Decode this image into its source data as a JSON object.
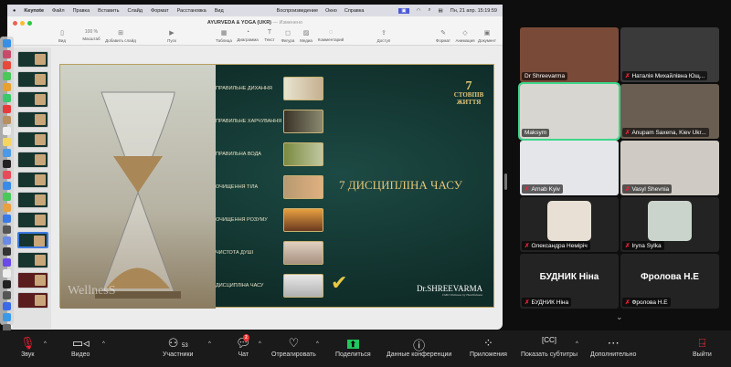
{
  "menubar": {
    "app": "Keynote",
    "items": [
      "Файл",
      "Правка",
      "Вставить",
      "Слайд",
      "Формат",
      "Расстановка",
      "Вид",
      "Воспроизведение",
      "Окно",
      "Справка"
    ],
    "datetime": "Пн, 21 апр. 15:19:59"
  },
  "window": {
    "title": "AYURVEDA & YOGA (UKR)",
    "status": "— Изменено"
  },
  "toolbar": {
    "view": "Вид",
    "zoom_value": "100 %",
    "zoom": "Масштаб",
    "add_slide": "Добавить слайд",
    "play": "Пуск",
    "table": "Таблица",
    "chart": "Диаграмма",
    "text": "Текст",
    "shape": "Фигура",
    "media": "Медиа",
    "comment": "Комментарий",
    "access": "Доступ",
    "format": "Формат",
    "animate": "Анимация",
    "document": "Документ"
  },
  "slide": {
    "title": "7 ДИСЦИПЛІНА ЧАСУ",
    "items": [
      "ПРАВИЛЬНЕ ДИХАННЯ",
      "ПРАВИЛЬНЕ ХАРЧУВАННЯ",
      "ПРАВИЛЬНА ВОДА",
      "ОЧИЩЕННЯ ТІЛА",
      "ОЧИЩЕННЯ РОЗУМУ",
      "ЧИСТОТА ДУШІ",
      "ДИСЦИПЛІНА ЧАСУ"
    ],
    "logo_number": "7",
    "logo_text": "СТОВПІВ ЖИТТЯ",
    "brand": "Dr.SHREEVARMA",
    "brand_sub": "CMD Wellness by Heartfulness",
    "watermark": "WellnesS",
    "check": "✔"
  },
  "participants": [
    {
      "name": "Dr Shreevarma",
      "muted": false,
      "color": "#7a4a38"
    },
    {
      "name": "Наталія Михайлівна Ющ...",
      "muted": true,
      "color": "#3a3a3a"
    },
    {
      "name": "Maksym",
      "muted": false,
      "color": "#d8d6d0",
      "active": true
    },
    {
      "name": "Anupam Saxena, Kiev Ukr...",
      "muted": true,
      "color": "#6a5e52"
    },
    {
      "name": "Arnab Kyiv",
      "muted": true,
      "color": "#e5e6ea"
    },
    {
      "name": "Vasyl Shevnia",
      "muted": true,
      "color": "#cfcac3"
    },
    {
      "name": "Олександра Немірiч",
      "muted": true,
      "avatar": "#e8e0d4"
    },
    {
      "name": "Iryna Sylka",
      "muted": true,
      "avatar": "#cbd4cc"
    },
    {
      "name": "БУДНИК Ніна",
      "muted": true,
      "big": "БУДНИК Ніна"
    },
    {
      "name": "Фролова Н.Е",
      "muted": true,
      "big": "Фролова Н.Е"
    }
  ],
  "bottom": {
    "audio": "Звук",
    "video": "Видео",
    "participants": "Участники",
    "participants_count": "53",
    "chat": "Чат",
    "chat_badge": "2",
    "react": "Отреагировать",
    "share": "Поделиться",
    "info": "Данные конференции",
    "apps": "Приложения",
    "captions": "Показать субтитры",
    "more": "Дополнительно",
    "leave": "Выйти"
  }
}
